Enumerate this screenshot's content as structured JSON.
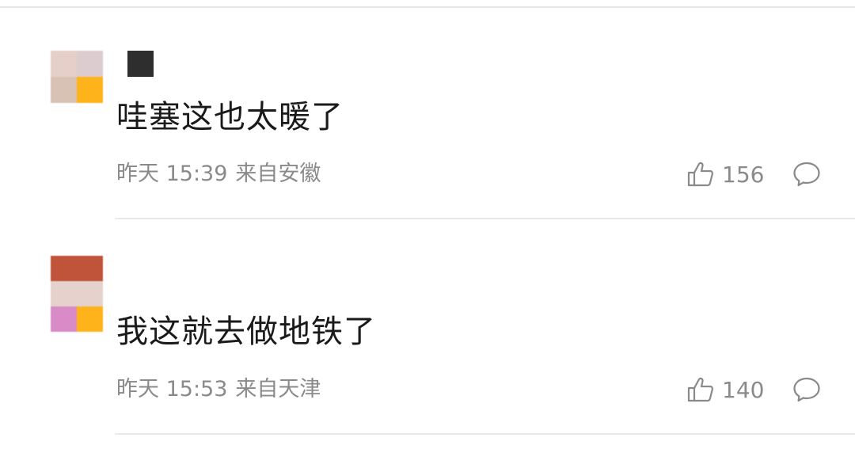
{
  "comments": [
    {
      "avatar_colors": [
        "#e6cfc9",
        "#dcccd0",
        "#d8c2b4",
        "#ffb31a"
      ],
      "username_block_color": "#2e2e2e",
      "text": "哇塞这也太暖了",
      "time": "昨天 15:39",
      "location": "来自安徽",
      "likes": "156",
      "like_icon": "thumbs-up-icon",
      "reply_icon": "comment-bubble-icon"
    },
    {
      "avatar_colors": [
        "#c0543a",
        "#e5d2cd",
        "#d88bc7",
        "#ffb31a"
      ],
      "text": "我这就去做地铁了",
      "time": "昨天 15:53",
      "location": "来自天津",
      "likes": "140",
      "like_icon": "thumbs-up-icon",
      "reply_icon": "comment-bubble-icon"
    }
  ]
}
